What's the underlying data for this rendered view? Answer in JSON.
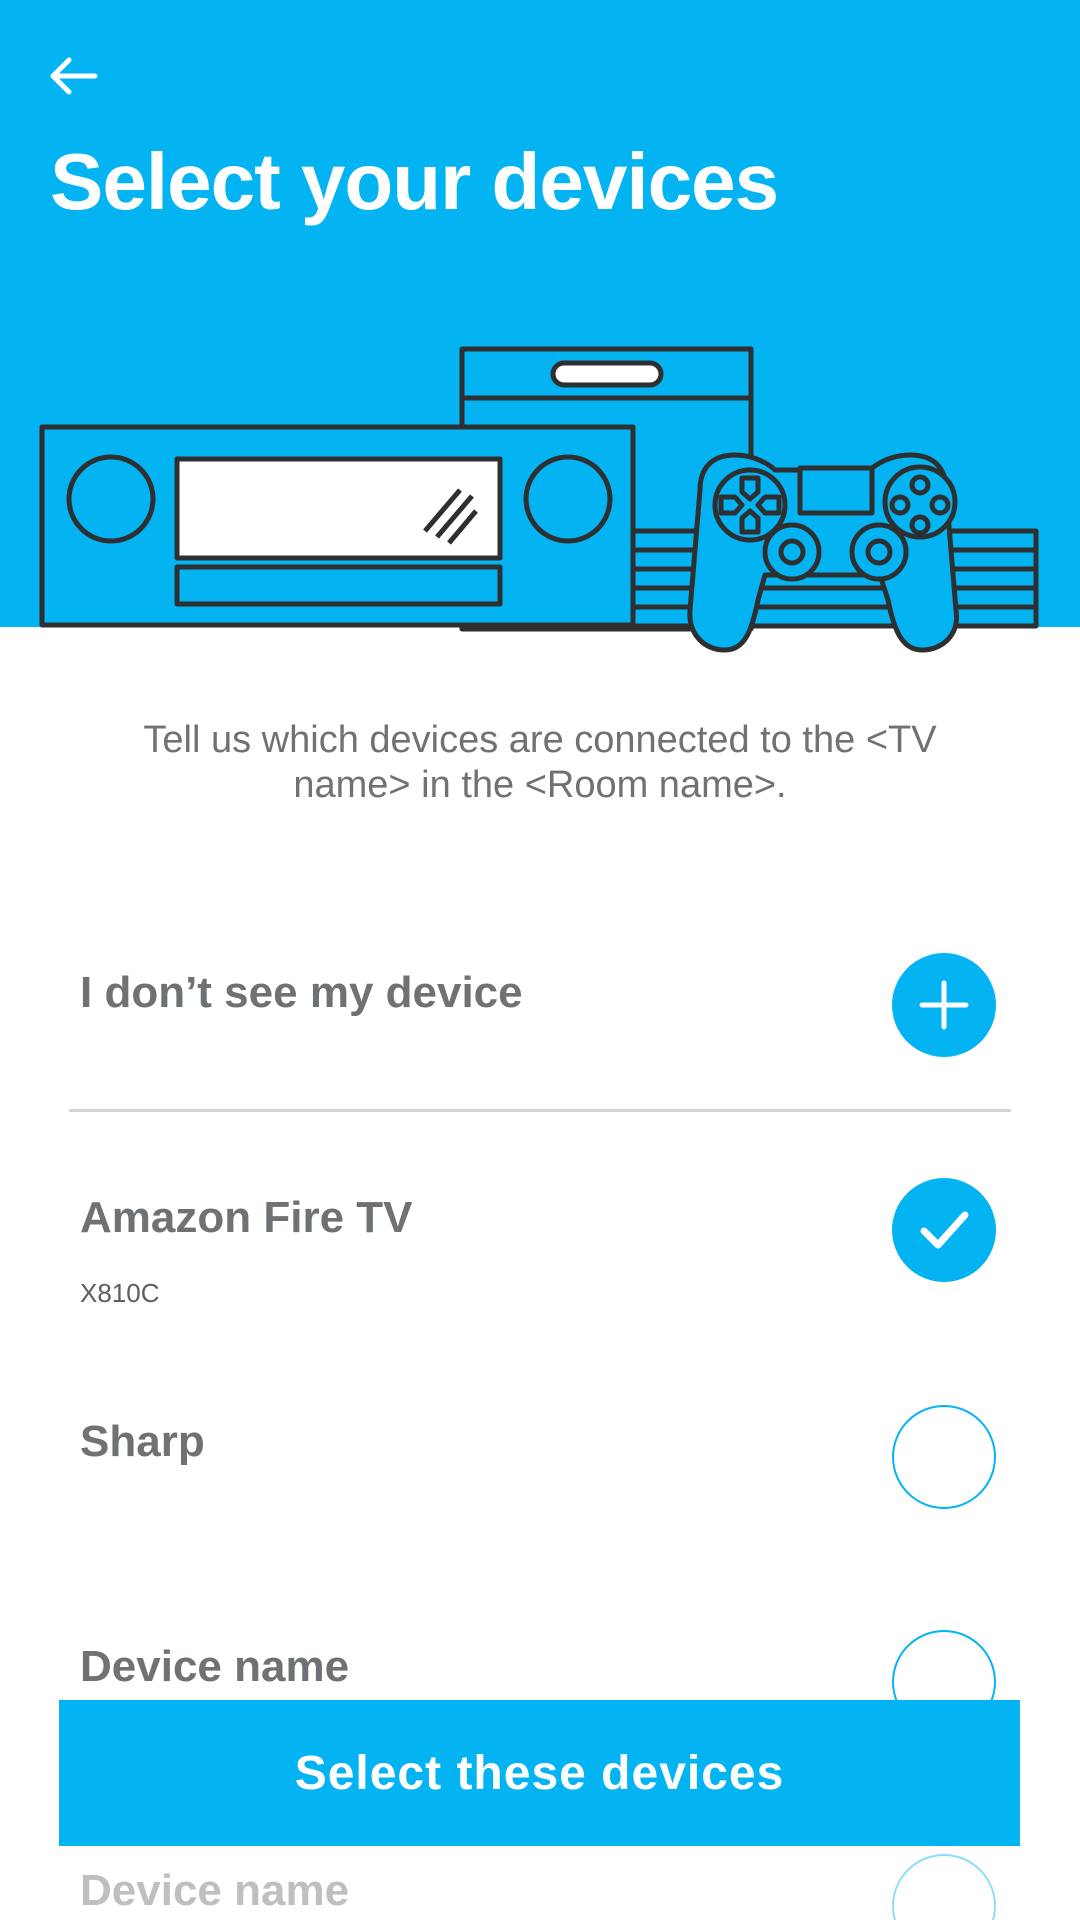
{
  "header": {
    "back_icon": "arrow-left-icon",
    "title": "Select your devices",
    "background_color": "#03b3f2"
  },
  "subtitle": "Tell us which devices are connected to the <TV name> in the <Room name>.",
  "add_device": {
    "label": "I don’t see my device",
    "icon": "plus-icon"
  },
  "devices": [
    {
      "name": "Amazon Fire TV",
      "model": "X810C",
      "selected": true
    },
    {
      "name": "Sharp",
      "model": "",
      "selected": false
    },
    {
      "name": "Device name",
      "model": "",
      "selected": false
    },
    {
      "name": "Device name",
      "model": "",
      "selected": false
    }
  ],
  "cta": {
    "label": "Select these devices"
  },
  "colors": {
    "accent": "#03b3f2",
    "text": "#6f7274",
    "divider": "#d2d4d5",
    "outline": "#2d2f31"
  }
}
